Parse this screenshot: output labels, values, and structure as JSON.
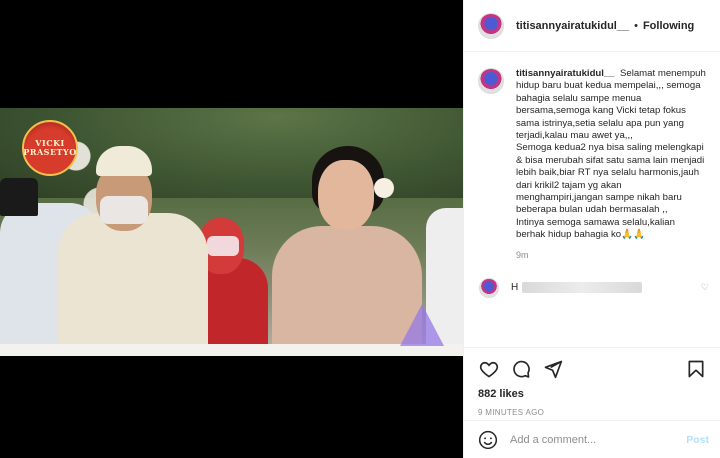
{
  "media": {
    "channel_badge": "VICKI PRASETYO"
  },
  "header": {
    "username": "titisannyairatukidul__",
    "separator": "•",
    "follow_label": "Following"
  },
  "caption": {
    "username": "titisannyairatukidul__",
    "paragraphs": [
      "Selamat menempuh hidup baru buat kedua mempelai,,, semoga bahagia selalu sampe menua bersama,semoga kang Vicki tetap fokus sama istrinya,setia selalu apa pun yang terjadi,kalau mau awet ya,,,",
      "Semoga kedua2 nya bisa saling melengkapi & bisa merubah sifat satu sama lain menjadi lebih baik,biar RT nya selalu harmonis,jauh dari krikil2 tajam yg akan menghampiri,jangan sampe nikah baru beberapa bulan udah bermasalah ,,",
      "Intinya semoga samawa selalu,kalian berhak hidup bahagia ko🙏🙏"
    ],
    "time": "9m"
  },
  "reply": {
    "initial": "H"
  },
  "actions": {
    "icons": [
      "heart-icon",
      "comment-icon",
      "share-icon",
      "bookmark-icon"
    ]
  },
  "likes": "882 likes",
  "posted": "9 MINUTES AGO",
  "add_comment": {
    "placeholder": "Add a comment...",
    "post_label": "Post"
  },
  "colors": {
    "post_disabled": "#b2dffc",
    "meta_gray": "#8e8e8e",
    "text": "#262626"
  }
}
